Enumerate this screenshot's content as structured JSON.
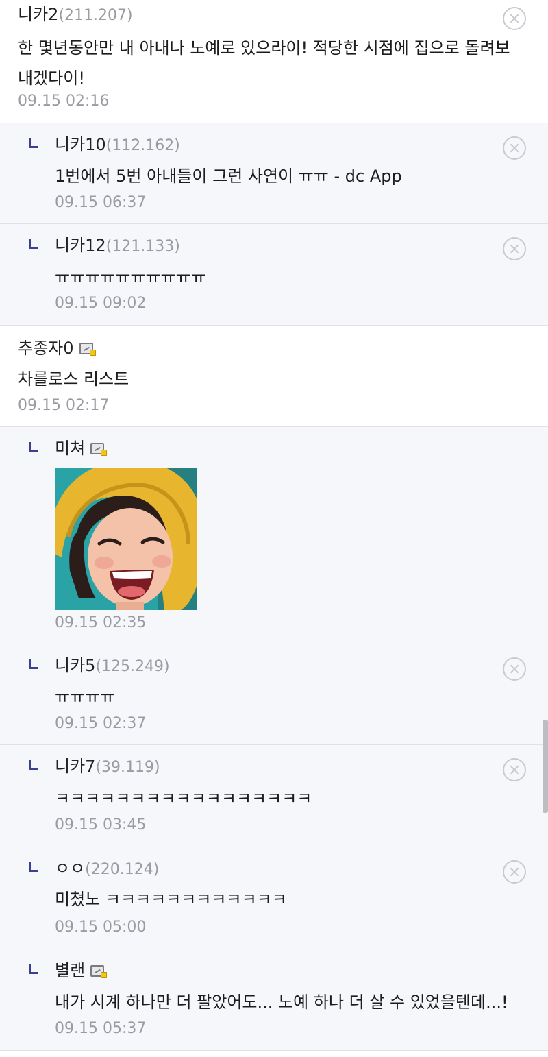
{
  "comments": [
    {
      "nick": "니카2",
      "ip": "(211.207)",
      "text": "한 몇년동안만 내 아내나 노예로 있으라이! 적당한 시점에 집으로 돌려보\n내겠다이!",
      "time": "09.15 02:16"
    },
    {
      "nick": "니카10",
      "ip": "(112.162)",
      "text": "1번에서 5번 아내들이 그런 사연이 ㅠㅠ - dc App",
      "time": "09.15 06:37"
    },
    {
      "nick": "니카12",
      "ip": "(121.133)",
      "text": "ㅠㅠㅠㅠㅠㅠㅠㅠㅠㅠ",
      "time": "09.15 09:02"
    },
    {
      "nick": "추종자0",
      "text": "차를로스 리스트",
      "time": "09.15 02:17"
    },
    {
      "nick": "미쳐",
      "time": "09.15 02:35"
    },
    {
      "nick": "니카5",
      "ip": "(125.249)",
      "text": "ㅠㅠㅠㅠ",
      "time": "09.15 02:37"
    },
    {
      "nick": "니카7",
      "ip": "(39.119)",
      "text": "ㅋㅋㅋㅋㅋㅋㅋㅋㅋㅋㅋㅋㅋㅋㅋㅋㅋ",
      "time": "09.15 03:45"
    },
    {
      "nick": "ㅇㅇ",
      "ip": "(220.124)",
      "text": "미쳤노 ㅋㅋㅋㅋㅋㅋㅋㅋㅋㅋㅋㅋ",
      "time": "09.15 05:00"
    },
    {
      "nick": "별랜",
      "text": "내가 시계 하나만 더 팔았어도... 노예 하나 더 살 수 있었을텐데...!",
      "time": "09.15 05:37"
    }
  ],
  "icons": {
    "reply": "reply-arrow-icon",
    "member": "member-badge-icon",
    "delete": "delete-circle-x-icon"
  },
  "colors": {
    "reply_mark": "#3b4190",
    "reply_background": "#f6f7fb",
    "meta_gray": "#9a9aa2"
  }
}
